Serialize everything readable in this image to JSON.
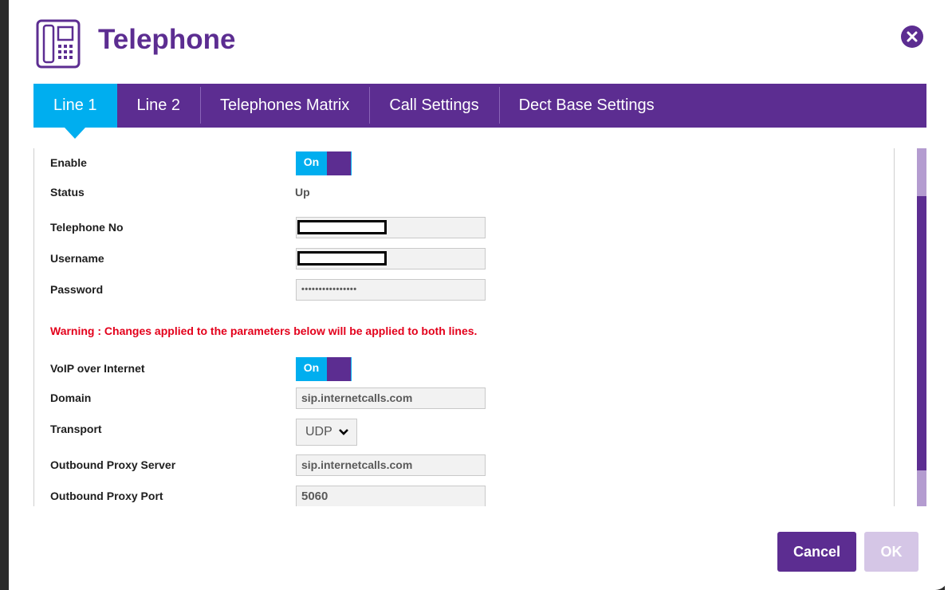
{
  "header": {
    "title": "Telephone",
    "icon": "telephone-icon",
    "close_icon": "close-icon"
  },
  "tabs": [
    {
      "label": "Line 1",
      "active": true
    },
    {
      "label": "Line 2",
      "active": false
    },
    {
      "label": "Telephones Matrix",
      "active": false
    },
    {
      "label": "Call Settings",
      "active": false
    },
    {
      "label": "Dect Base Settings",
      "active": false
    }
  ],
  "form": {
    "enable": {
      "label": "Enable",
      "toggle": "On"
    },
    "status": {
      "label": "Status",
      "value": "Up"
    },
    "telephone_no": {
      "label": "Telephone No",
      "value": ""
    },
    "username": {
      "label": "Username",
      "value": ""
    },
    "password": {
      "label": "Password",
      "value": "••••••••••••••••"
    },
    "warning": "Warning : Changes applied to the parameters below will be applied to both lines.",
    "voip": {
      "label": "VoIP over Internet",
      "toggle": "On"
    },
    "domain": {
      "label": "Domain",
      "value": "sip.internetcalls.com"
    },
    "transport": {
      "label": "Transport",
      "value": "UDP"
    },
    "outbound_server": {
      "label": "Outbound Proxy Server",
      "value": "sip.internetcalls.com"
    },
    "outbound_port": {
      "label": "Outbound Proxy Port",
      "value": "5060"
    }
  },
  "footer": {
    "cancel": "Cancel",
    "ok": "OK"
  },
  "colors": {
    "brand_purple": "#5c2d91",
    "accent_cyan": "#00aeef",
    "warning_red": "#e3001b"
  }
}
